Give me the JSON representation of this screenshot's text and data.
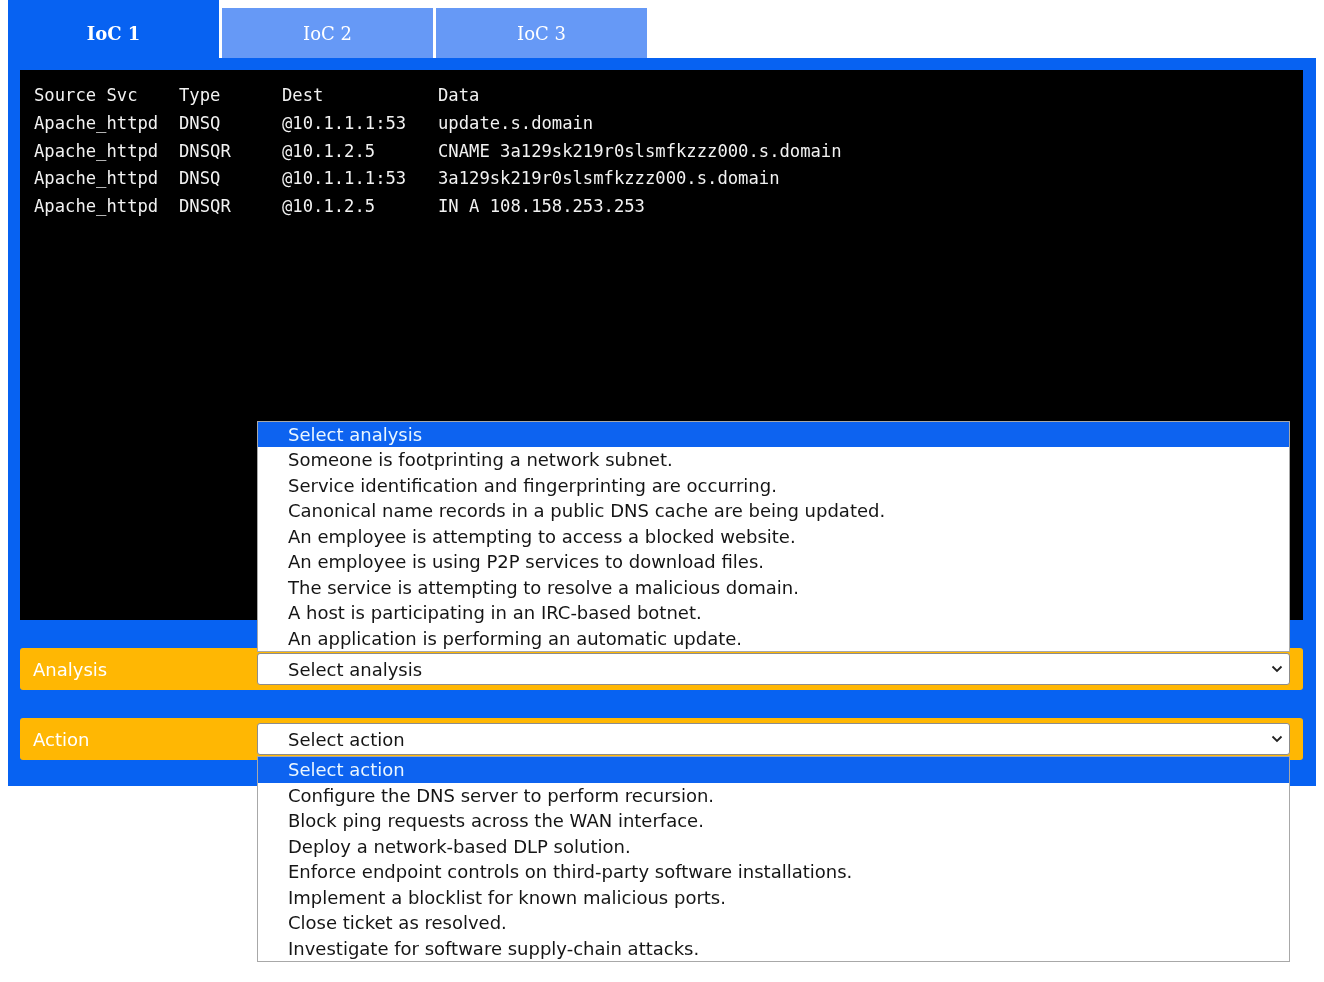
{
  "tabs": [
    {
      "label": "IoC 1",
      "selected": true
    },
    {
      "label": "IoC 2",
      "selected": false
    },
    {
      "label": "IoC 3",
      "selected": false
    }
  ],
  "log": {
    "columns": [
      "Source Svc",
      "Type",
      "Dest",
      "Data"
    ],
    "rows": [
      [
        "Apache_httpd",
        "DNSQ",
        "@10.1.1.1:53",
        "update.s.domain"
      ],
      [
        "Apache_httpd",
        "DNSQR",
        "@10.1.2.5",
        "CNAME 3a129sk219r0slsmfkzzz000.s.domain"
      ],
      [
        "Apache_httpd",
        "DNSQ",
        "@10.1.1.1:53",
        "3a129sk219r0slsmfkzzz000.s.domain"
      ],
      [
        "Apache_httpd",
        "DNSQR",
        "@10.1.2.5",
        "IN A 108.158.253.253"
      ]
    ]
  },
  "fields": [
    {
      "label": "Analysis",
      "dropdown": {
        "value": "Select analysis",
        "expanded": true,
        "opens_up": true,
        "options": [
          {
            "label": "Select analysis",
            "selected": true
          },
          {
            "label": "Someone is footprinting a network subnet.",
            "selected": false
          },
          {
            "label": "Service identification and fingerprinting are occurring.",
            "selected": false
          },
          {
            "label": "Canonical name records in a public DNS cache are being updated.",
            "selected": false
          },
          {
            "label": "An employee is attempting to access a blocked website.",
            "selected": false
          },
          {
            "label": "An employee is using P2P services to download files.",
            "selected": false
          },
          {
            "label": "The service is attempting to resolve a malicious domain.",
            "selected": false
          },
          {
            "label": "A host is participating in an IRC-based botnet.",
            "selected": false
          },
          {
            "label": "An application is performing an automatic update.",
            "selected": false
          }
        ]
      }
    },
    {
      "label": "Action",
      "dropdown": {
        "value": "Select action",
        "expanded": true,
        "opens_up": false,
        "options": [
          {
            "label": "Select action",
            "selected": true
          },
          {
            "label": "Configure the DNS server to perform recursion.",
            "selected": false
          },
          {
            "label": "Block ping requests across the WAN interface.",
            "selected": false
          },
          {
            "label": "Deploy a network-based DLP solution.",
            "selected": false
          },
          {
            "label": "Enforce endpoint controls on third-party software installations.",
            "selected": false
          },
          {
            "label": "Implement a blocklist for known malicious ports.",
            "selected": false
          },
          {
            "label": "Close ticket as resolved.",
            "selected": false
          },
          {
            "label": "Investigate for software supply-chain attacks.",
            "selected": false
          }
        ]
      }
    }
  ]
}
